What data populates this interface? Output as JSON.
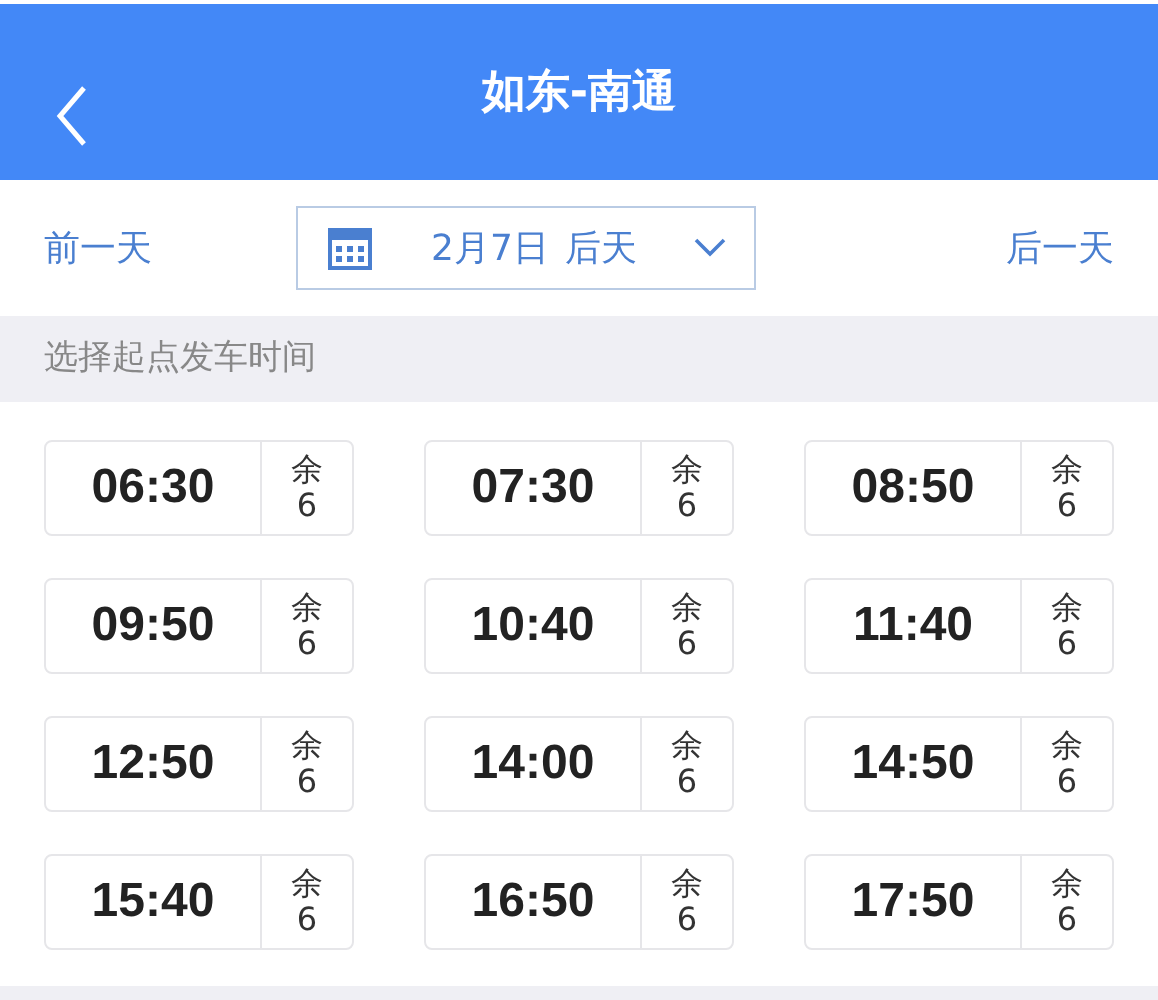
{
  "header": {
    "title": "如东-南通"
  },
  "date_bar": {
    "prev": "前一天",
    "date": "2月7日",
    "relative": "后天",
    "next": "后一天"
  },
  "section_label": "选择起点发车时间",
  "slots": [
    {
      "time": "06:30",
      "remain_label": "余",
      "seats": "6"
    },
    {
      "time": "07:30",
      "remain_label": "余",
      "seats": "6"
    },
    {
      "time": "08:50",
      "remain_label": "余",
      "seats": "6"
    },
    {
      "time": "09:50",
      "remain_label": "余",
      "seats": "6"
    },
    {
      "time": "10:40",
      "remain_label": "余",
      "seats": "6"
    },
    {
      "time": "11:40",
      "remain_label": "余",
      "seats": "6"
    },
    {
      "time": "12:50",
      "remain_label": "余",
      "seats": "6"
    },
    {
      "time": "14:00",
      "remain_label": "余",
      "seats": "6"
    },
    {
      "time": "14:50",
      "remain_label": "余",
      "seats": "6"
    },
    {
      "time": "15:40",
      "remain_label": "余",
      "seats": "6"
    },
    {
      "time": "16:50",
      "remain_label": "余",
      "seats": "6"
    },
    {
      "time": "17:50",
      "remain_label": "余",
      "seats": "6"
    }
  ]
}
